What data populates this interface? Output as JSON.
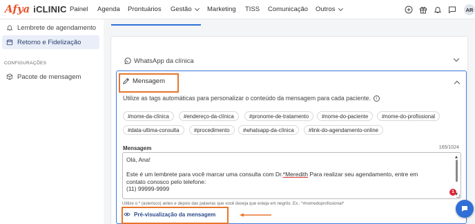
{
  "app": {
    "brand": "Afya",
    "brand_sub": "iCLINIC",
    "user_initials": "AR",
    "accent": "#2f6fd6",
    "brand_color": "#e8542b",
    "highlight_color": "#e8742b"
  },
  "nav": {
    "items": [
      {
        "label": "Painel",
        "dropdown": false
      },
      {
        "label": "Agenda",
        "dropdown": false
      },
      {
        "label": "Prontuários",
        "dropdown": false
      },
      {
        "label": "Gestão",
        "dropdown": true
      },
      {
        "label": "Marketing",
        "dropdown": false
      },
      {
        "label": "TISS",
        "dropdown": false
      },
      {
        "label": "Comunicação",
        "dropdown": false
      },
      {
        "label": "Outros",
        "dropdown": true
      }
    ],
    "icons": [
      "add-circle-icon",
      "gift-icon",
      "bell-icon",
      "chat-icon"
    ]
  },
  "sidebar": {
    "items": [
      {
        "label": "Lembrete de agendamento",
        "icon": "bell-icon",
        "active": false
      },
      {
        "label": "Retorno e Fidelização",
        "icon": "calendar-icon",
        "active": true
      }
    ],
    "section_title": "CONFIGURAÇÕES",
    "config_items": [
      {
        "label": "Pacote de mensagem",
        "icon": "box-icon"
      }
    ]
  },
  "whatsapp": {
    "label": "WhatsApp da clínica"
  },
  "message": {
    "title": "Mensagem",
    "instruction": "Utilize as tags automáticas para personalizar o conteúdo da mensagem para cada paciente.",
    "tags": [
      "#nome-da-clínica",
      "#endereço-da-clínica",
      "#pronome-de-tratamento",
      "#nome-do-paciente",
      "#nome-do-profissional",
      "#data-ultima-consulta",
      "#procedimento",
      "#whatsapp-da-clínica",
      "#link-do-agendamento-online"
    ],
    "field_label": "Mensagem",
    "counter": "165/1024",
    "body": {
      "line1": "Olá, Ana!",
      "line2_prefix": "Este é um lembrete para você marcar uma consulta com Dr.",
      "line2_name": "*Meredith",
      "line2_suffix": " Para realizar seu agendamento, entre em",
      "line3": "contato conosco pelo telefone:",
      "line4": "(11) 99999-9999"
    },
    "badge_count": "1",
    "hint": "Utilize o * (asterisco) antes e depois das palavras que você deseja que esteja em negrito. Ex.: *#nomedoprofissional*",
    "preview_label": "Pré-visualização da mensagem"
  }
}
